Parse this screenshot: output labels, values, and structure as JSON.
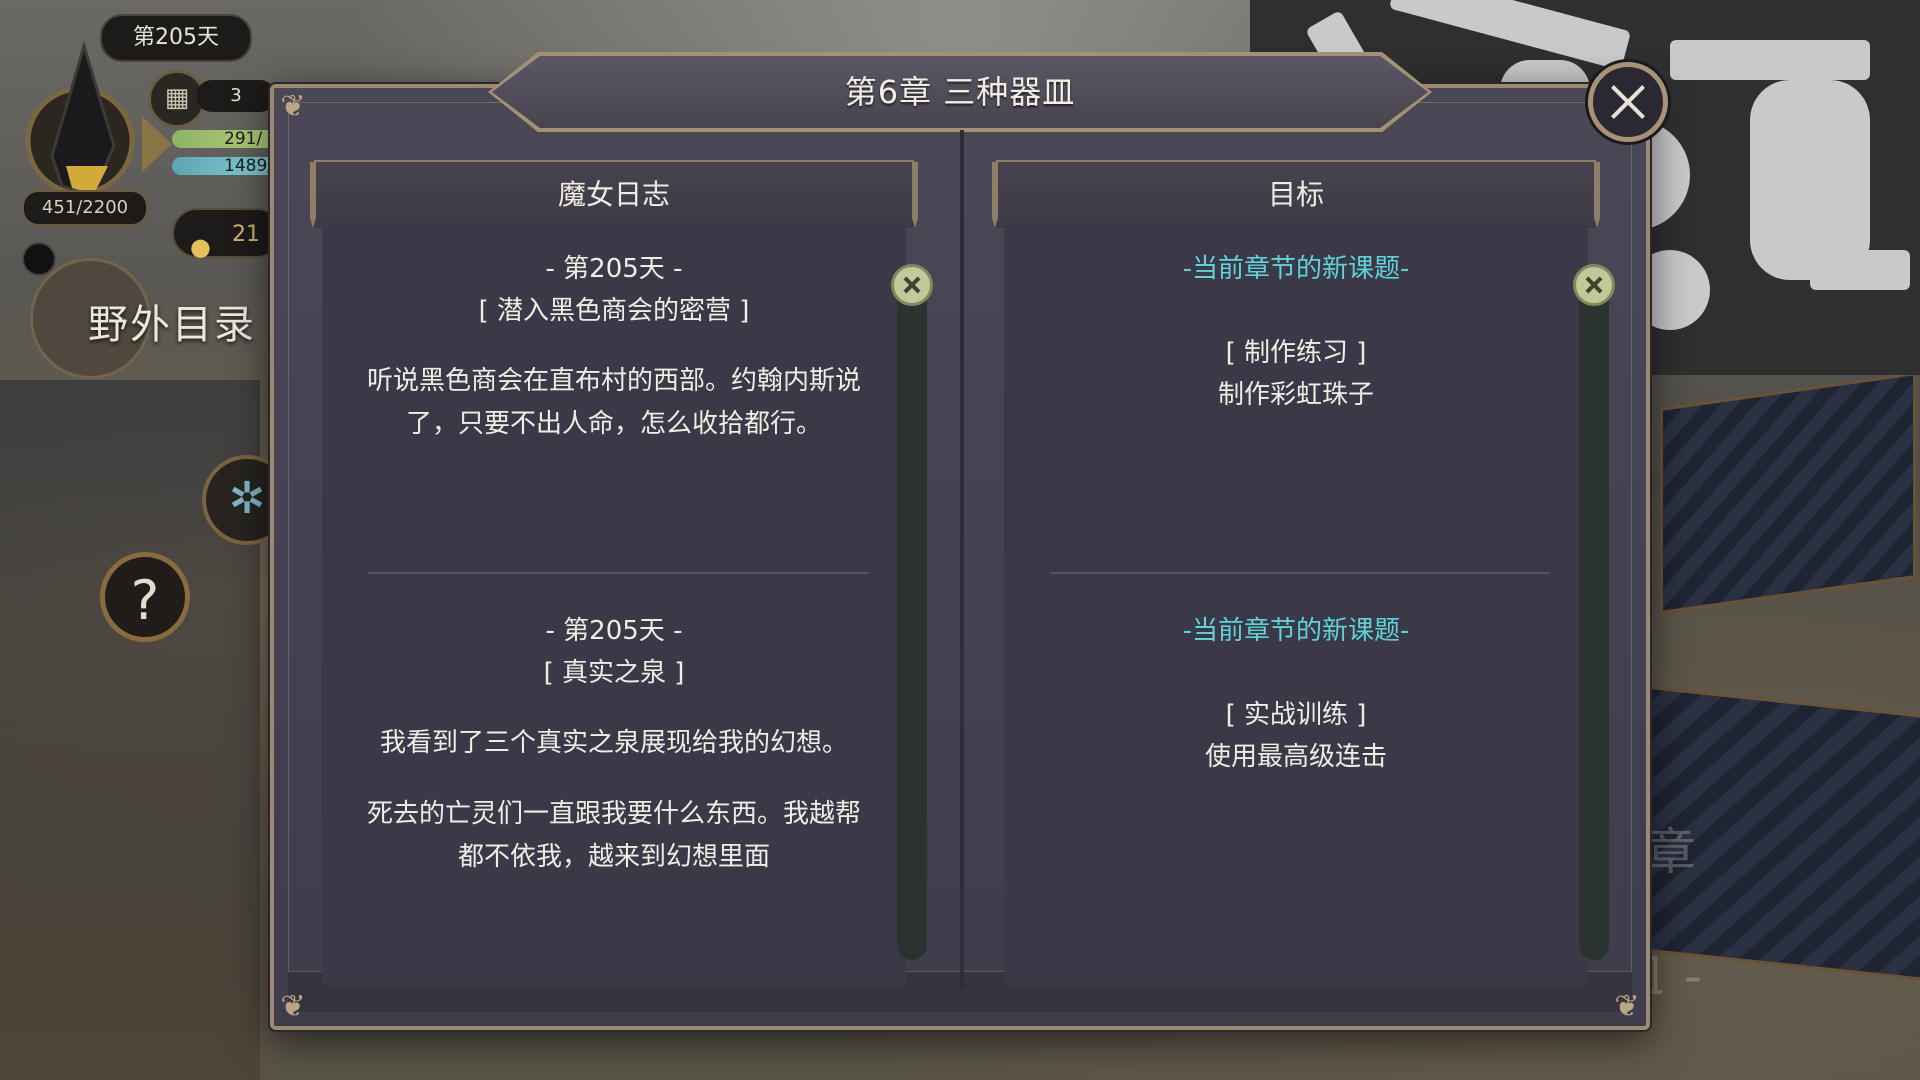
{
  "hud": {
    "day": "第205天",
    "calendar_count": "3",
    "hp": "291/",
    "mp": "1489/",
    "stamina": "451/2200",
    "gold": "21",
    "field_catalog": "野外目录",
    "help": "?"
  },
  "dialog": {
    "title": "第6章  三种器皿",
    "left_header": "魔女日志",
    "right_header": "目标"
  },
  "journal": [
    {
      "day": "- 第205天 -",
      "title": "[ 潜入黑色商会的密营 ]",
      "text": "听说黑色商会在直布村的西部。约翰内斯说了，只要不出人命，怎么收拾都行。"
    },
    {
      "day": "- 第205天 -",
      "title": "[ 真实之泉 ]",
      "text": "我看到了三个真实之泉展现给我的幻想。",
      "text2": "死去的亡灵们一直跟我要什么东西。我越帮都不依我，越来到幻想里面"
    }
  ],
  "goals": [
    {
      "heading": "-当前章节的新课题-",
      "task": "[ 制作练习 ]",
      "desc": "制作彩虹珠子"
    },
    {
      "heading": "-当前章节的新课题-",
      "task": "[ 实战训练 ]",
      "desc": "使用最高级连击"
    }
  ],
  "watermark": {
    "chapter": "第6章",
    "name": "- 三种器皿 -"
  },
  "colors": {
    "accent_cyan": "#5fd3d8",
    "frame_gold": "#9c8a6f",
    "panel_bg": "#3b3947"
  }
}
